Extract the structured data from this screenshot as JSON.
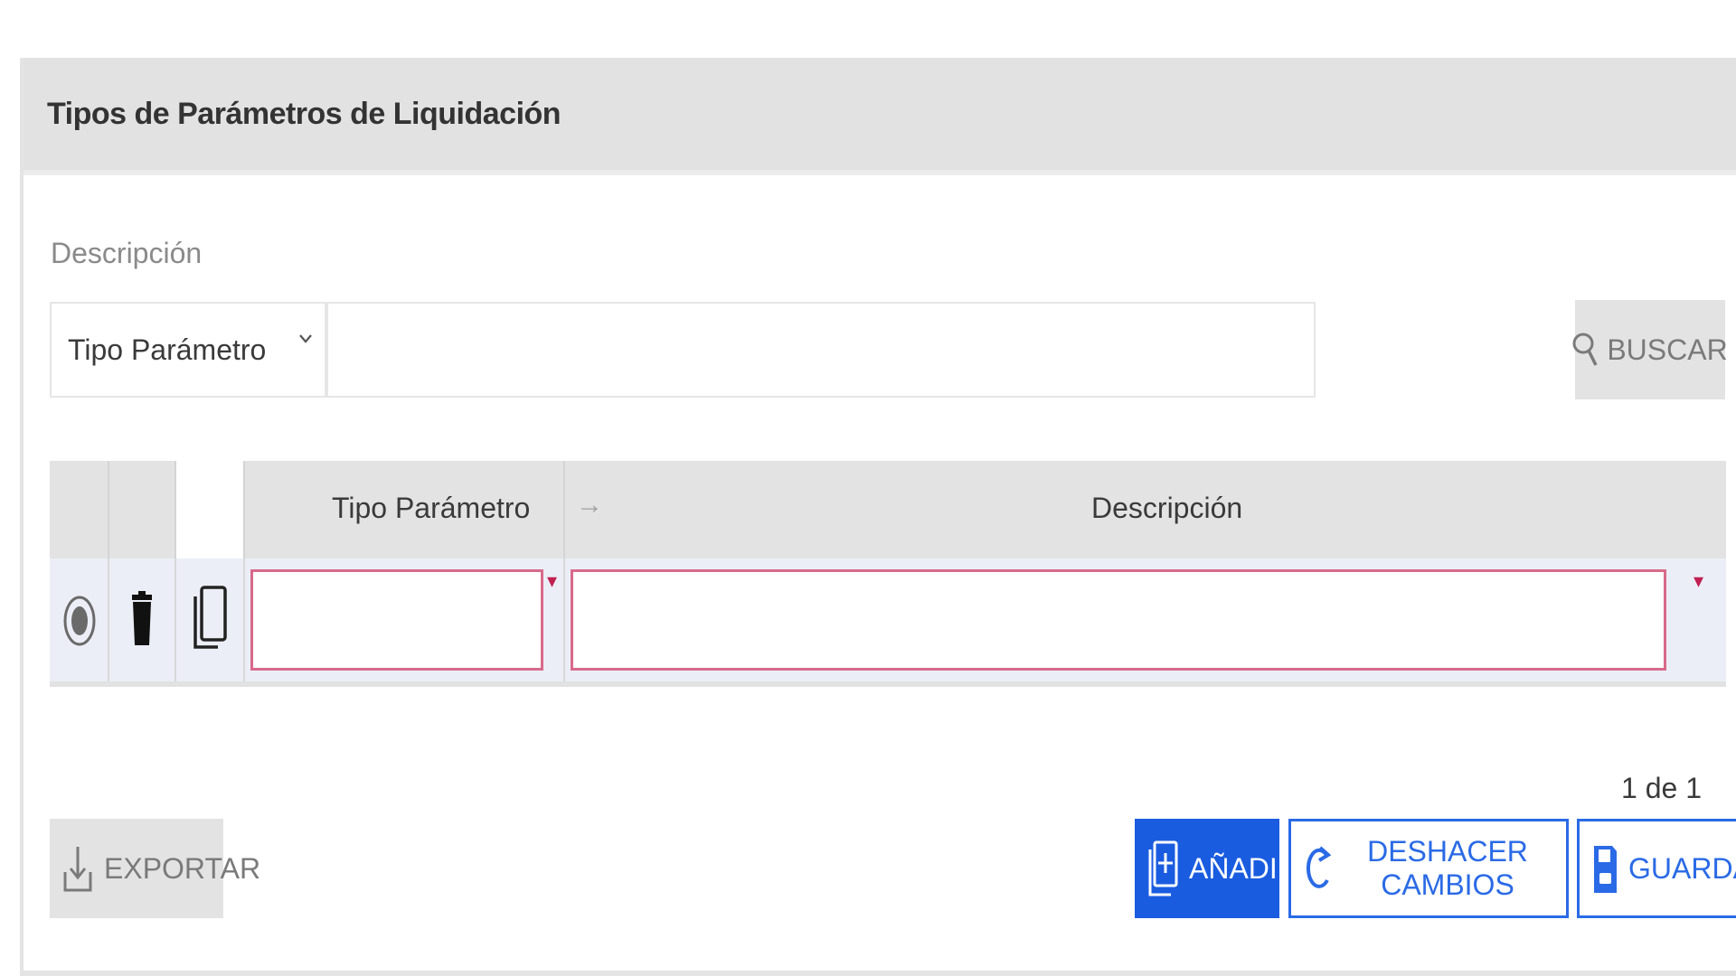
{
  "panel": {
    "title": "Tipos de Parámetros de Liquidación"
  },
  "filter": {
    "label": "Descripción",
    "select_value": "Tipo Parámetro",
    "input_value": "",
    "search_label": "BUSCAR"
  },
  "grid": {
    "columns": [
      "Tipo Parámetro",
      "Descripción"
    ],
    "rows": [
      {
        "tipo_parametro": "",
        "descripcion": ""
      }
    ]
  },
  "pagination": {
    "text": "1 de 1"
  },
  "actions": {
    "export_label": "EXPORTAR",
    "add_label": "AÑADIR",
    "undo_label": "DESHACER CAMBIOS",
    "save_label": "GUARDAR"
  },
  "colors": {
    "primary": "#1a5ce0",
    "required_border": "#d86a8a",
    "header_bg": "#e2e2e2"
  }
}
